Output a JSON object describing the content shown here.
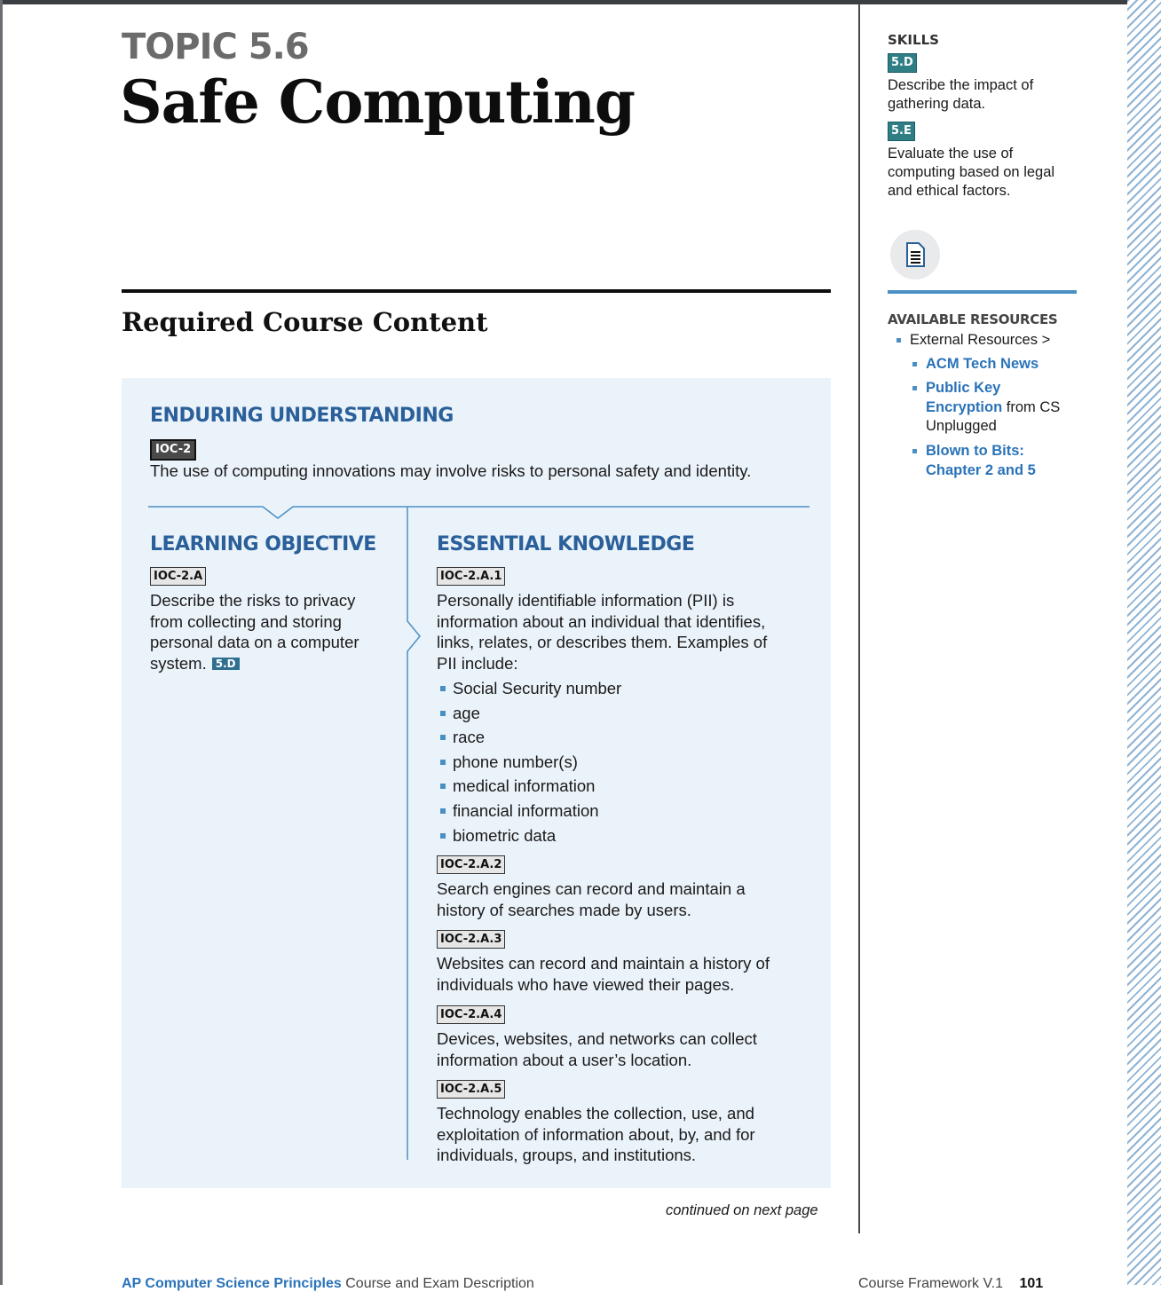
{
  "header": {
    "topic_label": "TOPIC 5.6",
    "title": "Safe Computing"
  },
  "section_title": "Required Course Content",
  "enduring_understanding": {
    "heading": "ENDURING UNDERSTANDING",
    "code": "IOC-2",
    "text": "The use of computing innovations may involve risks to personal safety and identity."
  },
  "learning_objective": {
    "heading": "LEARNING OBJECTIVE",
    "code": "IOC-2.A",
    "lines": [
      "Describe the risks to privacy",
      "from collecting and storing",
      "personal data on a computer",
      "system."
    ],
    "skill": "5.D"
  },
  "essential_knowledge": {
    "heading": "ESSENTIAL KNOWLEDGE",
    "items": [
      {
        "code": "IOC-2.A.1",
        "lines": [
          "Personally identifiable information (PII) is",
          "information about an individual that identifies,",
          "links, relates, or describes them. Examples of",
          "PII include:"
        ],
        "list": [
          "Social Security number",
          "age",
          "race",
          "phone number(s)",
          "medical information",
          "financial information",
          "biometric data"
        ]
      },
      {
        "code": "IOC-2.A.2",
        "lines": [
          "Search engines can record and maintain a",
          "history of searches made by users."
        ]
      },
      {
        "code": "IOC-2.A.3",
        "lines": [
          "Websites can record and maintain a history of",
          "individuals who have viewed their pages."
        ]
      },
      {
        "code": "IOC-2.A.4",
        "lines": [
          "Devices, websites, and networks can collect",
          "information about a user’s location."
        ]
      },
      {
        "code": "IOC-2.A.5",
        "lines": [
          "Technology enables the collection, use, and",
          "exploitation of information about, by, and for",
          "individuals, groups, and institutions."
        ]
      }
    ]
  },
  "continued": "continued on next page",
  "sidebar": {
    "skills_label": "SKILLS",
    "skills": [
      {
        "code": "5.D",
        "lines": [
          "Describe the impact of",
          "gathering data."
        ]
      },
      {
        "code": "5.E",
        "lines": [
          "Evaluate the use of",
          "computing based on legal",
          "and ethical factors."
        ]
      }
    ],
    "doc_icon": "document-icon",
    "resources_label": "AVAILABLE RESOURCES",
    "external": "External Resources >",
    "res1": "ACM Tech News",
    "res2_link_a": "Public Key",
    "res2_link_b": "Encryption",
    "res2_rest_a": " from CS",
    "res2_rest_b": "Unplugged",
    "res3_a": "Blown to Bits:",
    "res3_b": "Chapter 2 and 5"
  },
  "footer": {
    "left_link": "AP Computer Science Principles",
    "left_text": "Course and Exam Description",
    "right_text": "Course Framework V.1",
    "page_number": "101"
  },
  "colors": {
    "heading_blue": "#2a5f9a",
    "link_blue": "#2a73b8",
    "panel_bg": "#ebf3fa",
    "skill_teal": "#2f7e86"
  }
}
